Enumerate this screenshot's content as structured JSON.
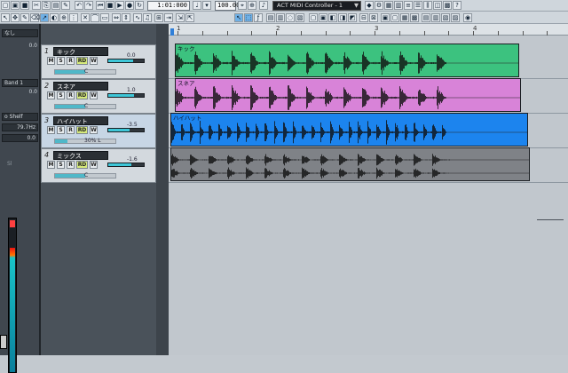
{
  "toolbar": {
    "time_display": "1:01:000",
    "tempo": "100.00",
    "controller": "ACT MIDI Controller - 1",
    "controller_arrow": "▼"
  },
  "inspector": {
    "rows": [
      "なし",
      "0.0",
      "Band 1",
      "0.0",
      "o Shelf",
      "79.7Hz",
      "0.0",
      "Sl"
    ]
  },
  "tracks": [
    {
      "num": "1",
      "name": "キック",
      "m": "M",
      "s": "S",
      "r": "R",
      "rd": "RD",
      "w": "W",
      "vol": "0.0",
      "vol_level": 0.7,
      "pan": "C",
      "pan_level": 0.5
    },
    {
      "num": "2",
      "name": "スネア",
      "m": "M",
      "s": "S",
      "r": "R",
      "rd": "RD",
      "w": "W",
      "vol": "1.0",
      "vol_level": 0.72,
      "pan": "C",
      "pan_level": 0.5
    },
    {
      "num": "3",
      "name": "ハイハット",
      "m": "M",
      "s": "S",
      "r": "R",
      "rd": "RD",
      "w": "W",
      "vol": "-3.5",
      "vol_level": 0.6,
      "pan": "30% L",
      "pan_level": 0.2
    },
    {
      "num": "4",
      "name": "ミックス",
      "m": "M",
      "s": "S",
      "r": "R",
      "rd": "RD",
      "w": "W",
      "vol": "-1.6",
      "vol_level": 0.66,
      "pan": "C",
      "pan_level": 0.5
    }
  ],
  "ruler": {
    "labels": [
      "1",
      "2",
      "3",
      "4"
    ]
  },
  "clips": [
    {
      "name": "キック",
      "color": "#3cc27f"
    },
    {
      "name": "スネア",
      "color": "#d883d8"
    },
    {
      "name": "ハイハット",
      "color": "#1c84ee"
    },
    {
      "name": "",
      "color": "#7f8287"
    }
  ]
}
